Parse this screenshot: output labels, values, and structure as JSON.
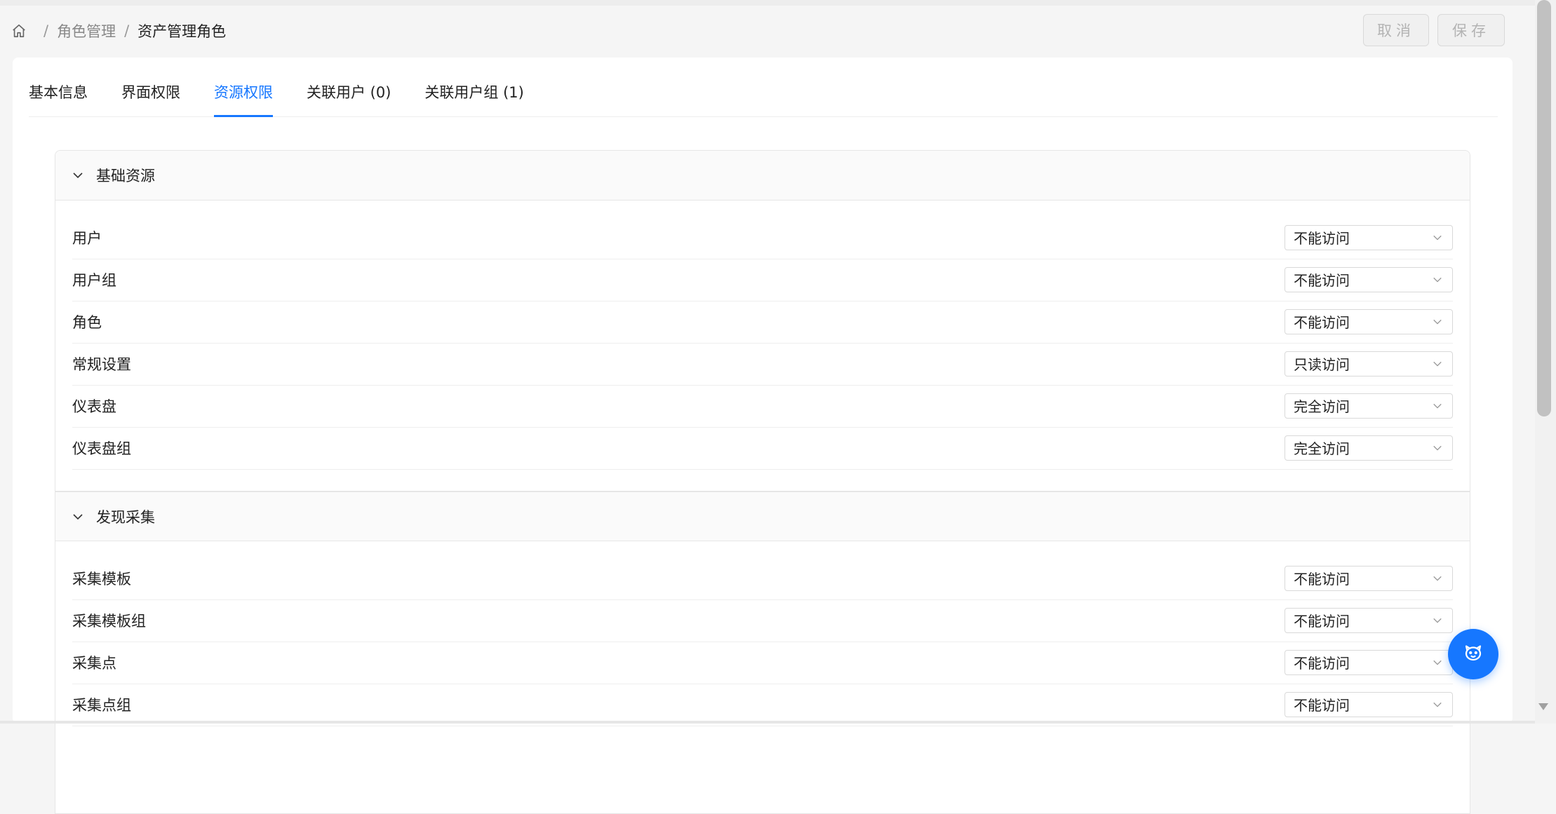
{
  "breadcrumb": {
    "items": [
      "角色管理",
      "资产管理角色"
    ],
    "separator": "/"
  },
  "header": {
    "cancel_label": "取消",
    "save_label": "保存"
  },
  "tabs": [
    {
      "label": "基本信息"
    },
    {
      "label": "界面权限"
    },
    {
      "label": "资源权限",
      "active": true
    },
    {
      "label": "关联用户 (0)"
    },
    {
      "label": "关联用户组 (1)"
    }
  ],
  "sections": [
    {
      "title": "基础资源",
      "rows": [
        {
          "label": "用户",
          "value": "不能访问"
        },
        {
          "label": "用户组",
          "value": "不能访问"
        },
        {
          "label": "角色",
          "value": "不能访问"
        },
        {
          "label": "常规设置",
          "value": "只读访问"
        },
        {
          "label": "仪表盘",
          "value": "完全访问"
        },
        {
          "label": "仪表盘组",
          "value": "完全访问"
        }
      ]
    },
    {
      "title": "发现采集",
      "rows": [
        {
          "label": "采集模板",
          "value": "不能访问"
        },
        {
          "label": "采集模板组",
          "value": "不能访问"
        },
        {
          "label": "采集点",
          "value": "不能访问"
        },
        {
          "label": "采集点组",
          "value": "不能访问"
        }
      ]
    }
  ],
  "colors": {
    "accent": "#1677ff",
    "text": "#222222",
    "muted": "#888888"
  },
  "icons": {
    "home": "home-icon",
    "collapse": "chevron-down-icon",
    "select_arrow": "chevron-down-icon",
    "assistant": "assistant-bot-icon"
  }
}
